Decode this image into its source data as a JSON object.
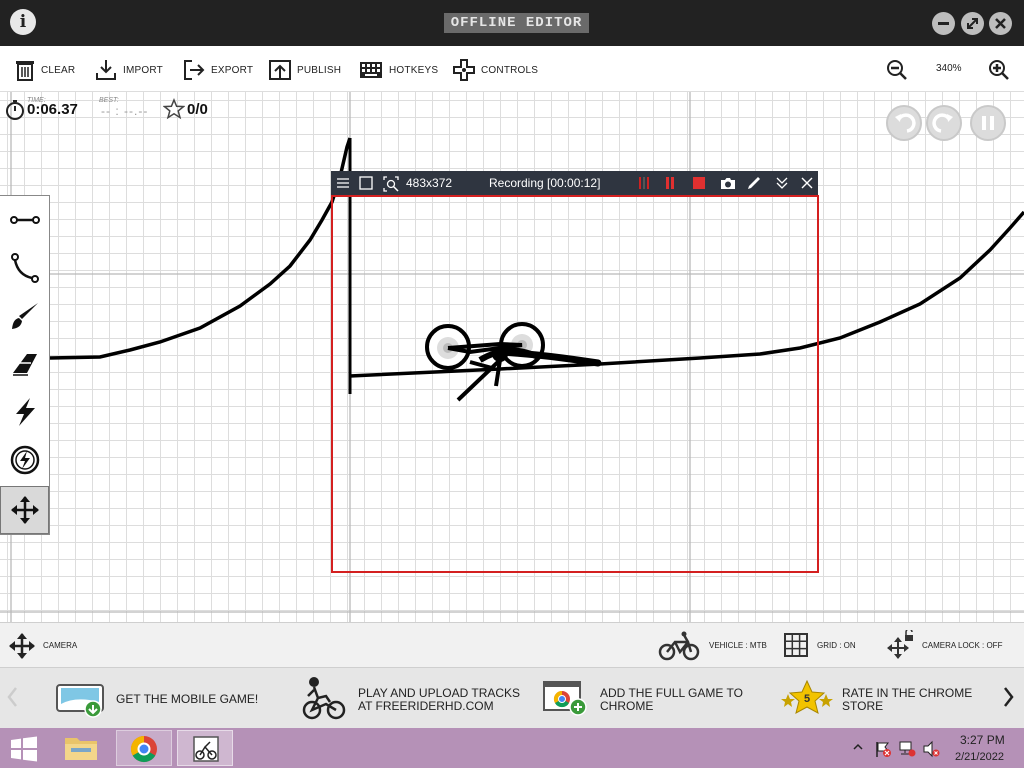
{
  "titlebar": {
    "title": "OFFLINE EDITOR",
    "info_icon": "i"
  },
  "toolbar": {
    "items": [
      {
        "label": "CLEAR",
        "icon": "trash-icon"
      },
      {
        "label": "IMPORT",
        "icon": "import-icon"
      },
      {
        "label": "EXPORT",
        "icon": "export-icon"
      },
      {
        "label": "PUBLISH",
        "icon": "publish-icon"
      },
      {
        "label": "HOTKEYS",
        "icon": "keyboard-icon"
      },
      {
        "label": "CONTROLS",
        "icon": "dpad-icon"
      }
    ],
    "zoom": "340%"
  },
  "hud": {
    "time_label": "TIME:",
    "time": "0:06.37",
    "best_label": "BEST:",
    "best": "-- : --.--",
    "stars": "0/0"
  },
  "tools": [
    "line-tool-icon",
    "curve-tool-icon",
    "brush-tool-icon",
    "eraser-tool-icon",
    "boost-tool-icon",
    "gravity-tool-icon",
    "camera-move-tool-icon"
  ],
  "recorder": {
    "size": "483x372",
    "status": "Recording [00:00:12]"
  },
  "statusbar": {
    "camera": "CAMERA",
    "vehicle": "VEHICLE : MTB",
    "grid": "GRID : ON",
    "camera_lock": "CAMERA LOCK : OFF"
  },
  "promos": [
    {
      "line1": "GET THE MOBILE GAME!",
      "line2": ""
    },
    {
      "line1": "PLAY AND UPLOAD TRACKS",
      "line2": "AT FREERIDERHD.COM"
    },
    {
      "line1": "ADD THE FULL GAME TO",
      "line2": "CHROME"
    },
    {
      "line1": "RATE IN THE CHROME",
      "line2": "STORE"
    }
  ],
  "promo_badge": "5",
  "taskbar": {
    "time": "3:27 PM",
    "date": "2/21/2022"
  },
  "colors": {
    "titlebar": "#222222",
    "recording_frame": "#d42020",
    "taskbar": "#b591b7"
  }
}
